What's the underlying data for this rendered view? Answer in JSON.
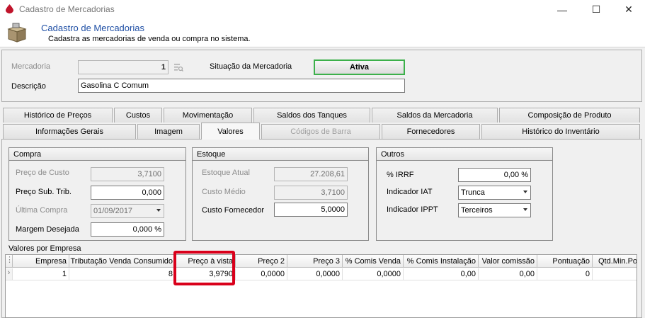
{
  "window": {
    "title": "Cadastro de Mercadorias",
    "minimize": "—",
    "maximize": "☐",
    "close": "✕"
  },
  "header": {
    "title": "Cadastro de Mercadorias",
    "subtitle": "Cadastra as mercadorias de venda ou compra no sistema."
  },
  "form": {
    "mercadoria_label": "Mercadoria",
    "mercadoria_value": "1",
    "situacao_label": "Situação da Mercadoria",
    "situacao_value": "Ativa",
    "situacao_color": "#3cb04a",
    "descricao_label": "Descrição",
    "descricao_value": "Gasolina C Comum"
  },
  "tabs_row1": [
    "Histórico de Preços",
    "Custos",
    "Movimentação",
    "Saldos dos Tanques",
    "Saldos da Mercadoria",
    "Composição de Produto"
  ],
  "tabs_row2": [
    "Informações Gerais",
    "Imagem",
    "Valores",
    "Códigos de Barra",
    "Fornecedores",
    "Histórico do Inventário"
  ],
  "active_tab": "Valores",
  "compra": {
    "title": "Compra",
    "preco_custo_label": "Preço de Custo",
    "preco_custo_value": "3,7100",
    "preco_sub_label": "Preço Sub. Trib.",
    "preco_sub_value": "0,000",
    "ultima_compra_label": "Última Compra",
    "ultima_compra_value": "01/09/2017",
    "margem_label": "Margem Desejada",
    "margem_value": "0,000 %"
  },
  "estoque": {
    "title": "Estoque",
    "atual_label": "Estoque Atual",
    "atual_value": "27.208,61",
    "medio_label": "Custo Médio",
    "medio_value": "3,7100",
    "fornecedor_label": "Custo Fornecedor",
    "fornecedor_value": "5,0000"
  },
  "outros": {
    "title": "Outros",
    "irrf_label": "% IRRF",
    "irrf_value": "0,00 %",
    "iat_label": "Indicador IAT",
    "iat_value": "Trunca",
    "ippt_label": "Indicador IPPT",
    "ippt_value": "Terceiros"
  },
  "grid": {
    "caption": "Valores por Empresa",
    "columns": [
      "Empresa",
      "Tributação Venda Consumido",
      "Preço à vista",
      "Preço 2",
      "Preço 3",
      "% Comis Venda",
      "% Comis Instalação",
      "Valor comissão",
      "Pontuação",
      "Qtd.Min.Po"
    ],
    "row": [
      "1",
      "8",
      "3,9790",
      "0,0000",
      "0,0000",
      "0,0000",
      "0,00",
      "0,00",
      "0",
      ""
    ],
    "highlight_color": "#d9001b"
  }
}
